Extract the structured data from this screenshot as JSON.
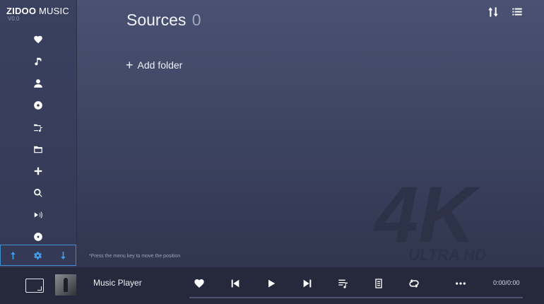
{
  "app": {
    "brand_bold": "ZIDOO",
    "brand_light": "MUSIC",
    "version": "V0.0"
  },
  "sidebar": {
    "items": [
      {
        "icon": "heart-icon"
      },
      {
        "icon": "music-note-icon"
      },
      {
        "icon": "person-icon"
      },
      {
        "icon": "disc-icon"
      },
      {
        "icon": "folder-music-icon"
      },
      {
        "icon": "folder-icon"
      },
      {
        "icon": "plus-icon"
      },
      {
        "icon": "search-icon"
      },
      {
        "icon": "play-sound-icon"
      },
      {
        "icon": "record-icon"
      }
    ],
    "bottom": [
      "arrow-up-icon",
      "gear-icon",
      "arrow-down-icon"
    ]
  },
  "header": {
    "title": "Sources",
    "count": "0"
  },
  "main": {
    "add_folder_label": "Add folder",
    "hint": "*Press the menu key to move the position"
  },
  "watermark": {
    "big": "4K",
    "small": "ULTRA HD"
  },
  "player": {
    "track_title": "Music Player",
    "time": "0:00/0:00",
    "progress": 0
  },
  "colors": {
    "accent": "#3ea0ee",
    "background": "#3c4362",
    "player_bar": "#25293b"
  }
}
